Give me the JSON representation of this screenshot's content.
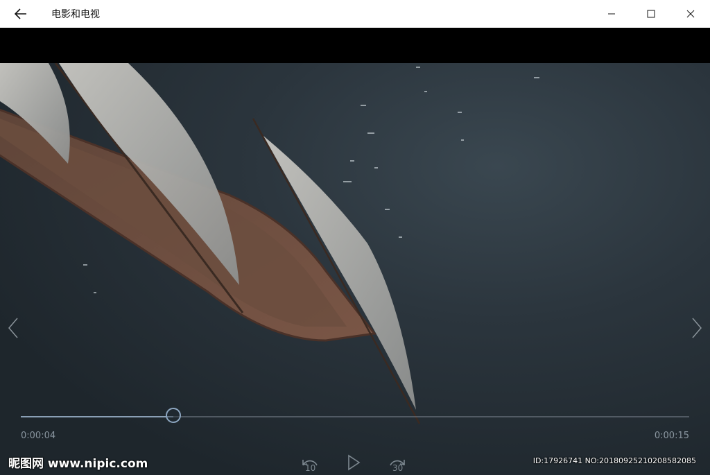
{
  "window": {
    "title": "电影和电视"
  },
  "player": {
    "current_time": "0:00:04",
    "total_time": "0:00:15",
    "progress": 0.228,
    "skip_back_seconds": "10",
    "skip_forward_seconds": "30"
  },
  "watermark": {
    "site_text": "昵图网 www.nipic.com",
    "id_text": "ID:17926741 NO:20180925210208582085"
  },
  "icons": {
    "back": "arrow-left-icon",
    "minimize": "minimize-icon",
    "maximize": "maximize-icon",
    "close": "close-icon",
    "prev": "chevron-left-icon",
    "next": "chevron-right-icon",
    "play": "play-icon",
    "skip_back": "rewind-10-icon",
    "skip_forward": "forward-30-icon"
  },
  "colors": {
    "titlebar_bg": "#ffffff",
    "letterbox": "#000000",
    "progress_accent": "#8da6c0"
  }
}
